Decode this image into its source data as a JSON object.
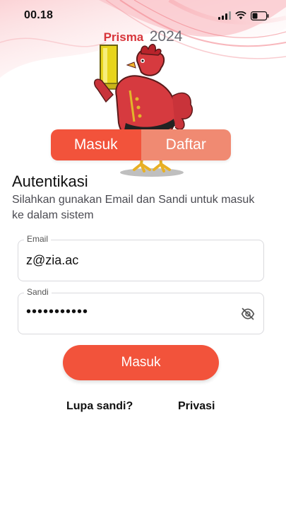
{
  "status_bar": {
    "time": "00.18"
  },
  "brand": {
    "name": "Prisma",
    "year": "2024"
  },
  "tabs": [
    {
      "label": "Masuk",
      "active": true
    },
    {
      "label": "Daftar",
      "active": false
    }
  ],
  "auth": {
    "title": "Autentikasi",
    "subtitle": "Silahkan gunakan Email dan Sandi untuk masuk ke dalam sistem"
  },
  "email_field": {
    "label": "Email",
    "value": "z@zia.ac"
  },
  "password_field": {
    "label": "Sandi",
    "masked_value": "•••••••••••"
  },
  "submit": {
    "label": "Masuk"
  },
  "links": {
    "forgot": "Lupa sandi?",
    "privacy": "Privasi"
  },
  "colors": {
    "accent": "#f2533b",
    "accent_light": "#f08a72",
    "brand_red": "#d7343a"
  },
  "icons": {
    "password_visibility": "eye-off-icon"
  }
}
